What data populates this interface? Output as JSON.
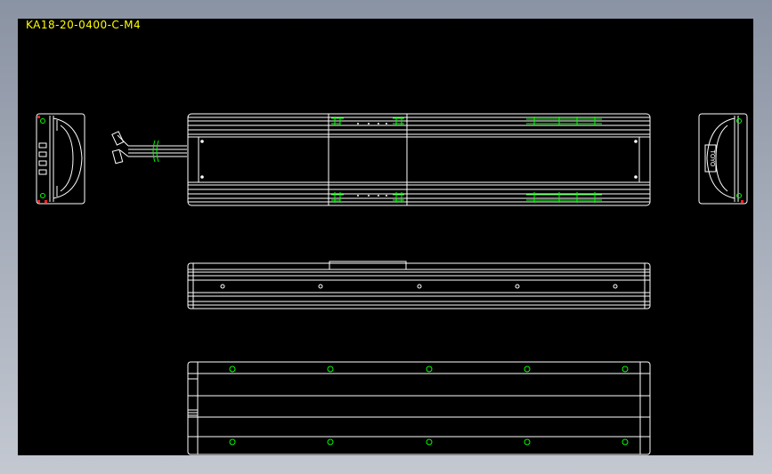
{
  "drawing": {
    "title": "KA18-20-0400-C-M4",
    "end_label": "TOYO"
  },
  "colors": {
    "background": "#000000",
    "line": "#ffffff",
    "title": "#ffff00",
    "accent": "#00ff00",
    "marker": "#ff2020"
  }
}
